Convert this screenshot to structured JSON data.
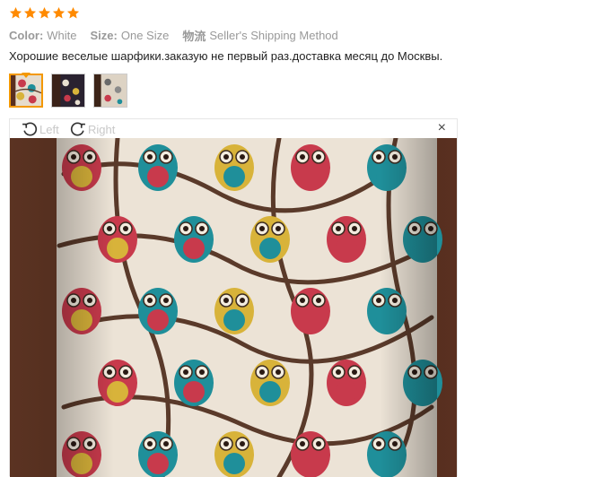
{
  "review": {
    "rating": 5,
    "attributes": [
      {
        "key": "Color:",
        "value": "White"
      },
      {
        "key": "Size:",
        "value": "One Size"
      },
      {
        "key": "物流",
        "value": "Seller's Shipping Method"
      }
    ],
    "text": "Хорошие веселые шарфики.заказую не первый раз.доставка месяц до Москвы."
  },
  "thumbnails": [
    {
      "name": "photo-1",
      "selected": true
    },
    {
      "name": "photo-2",
      "selected": false
    },
    {
      "name": "photo-3",
      "selected": false
    }
  ],
  "viewer": {
    "rotate_left_label": "Left",
    "rotate_right_label": "Right",
    "close_glyph": "×",
    "icons": [
      "rotate-left-icon",
      "rotate-right-icon",
      "close-icon"
    ]
  },
  "colors": {
    "star": "#ff8a00",
    "active_border": "#f39800",
    "owl_red": "#c83a4c",
    "owl_teal": "#1f8f9a",
    "owl_yellow": "#d8b33a",
    "branch": "#5a3a2a",
    "fabric": "#ece3d6",
    "wood": "#4a2a1c"
  }
}
